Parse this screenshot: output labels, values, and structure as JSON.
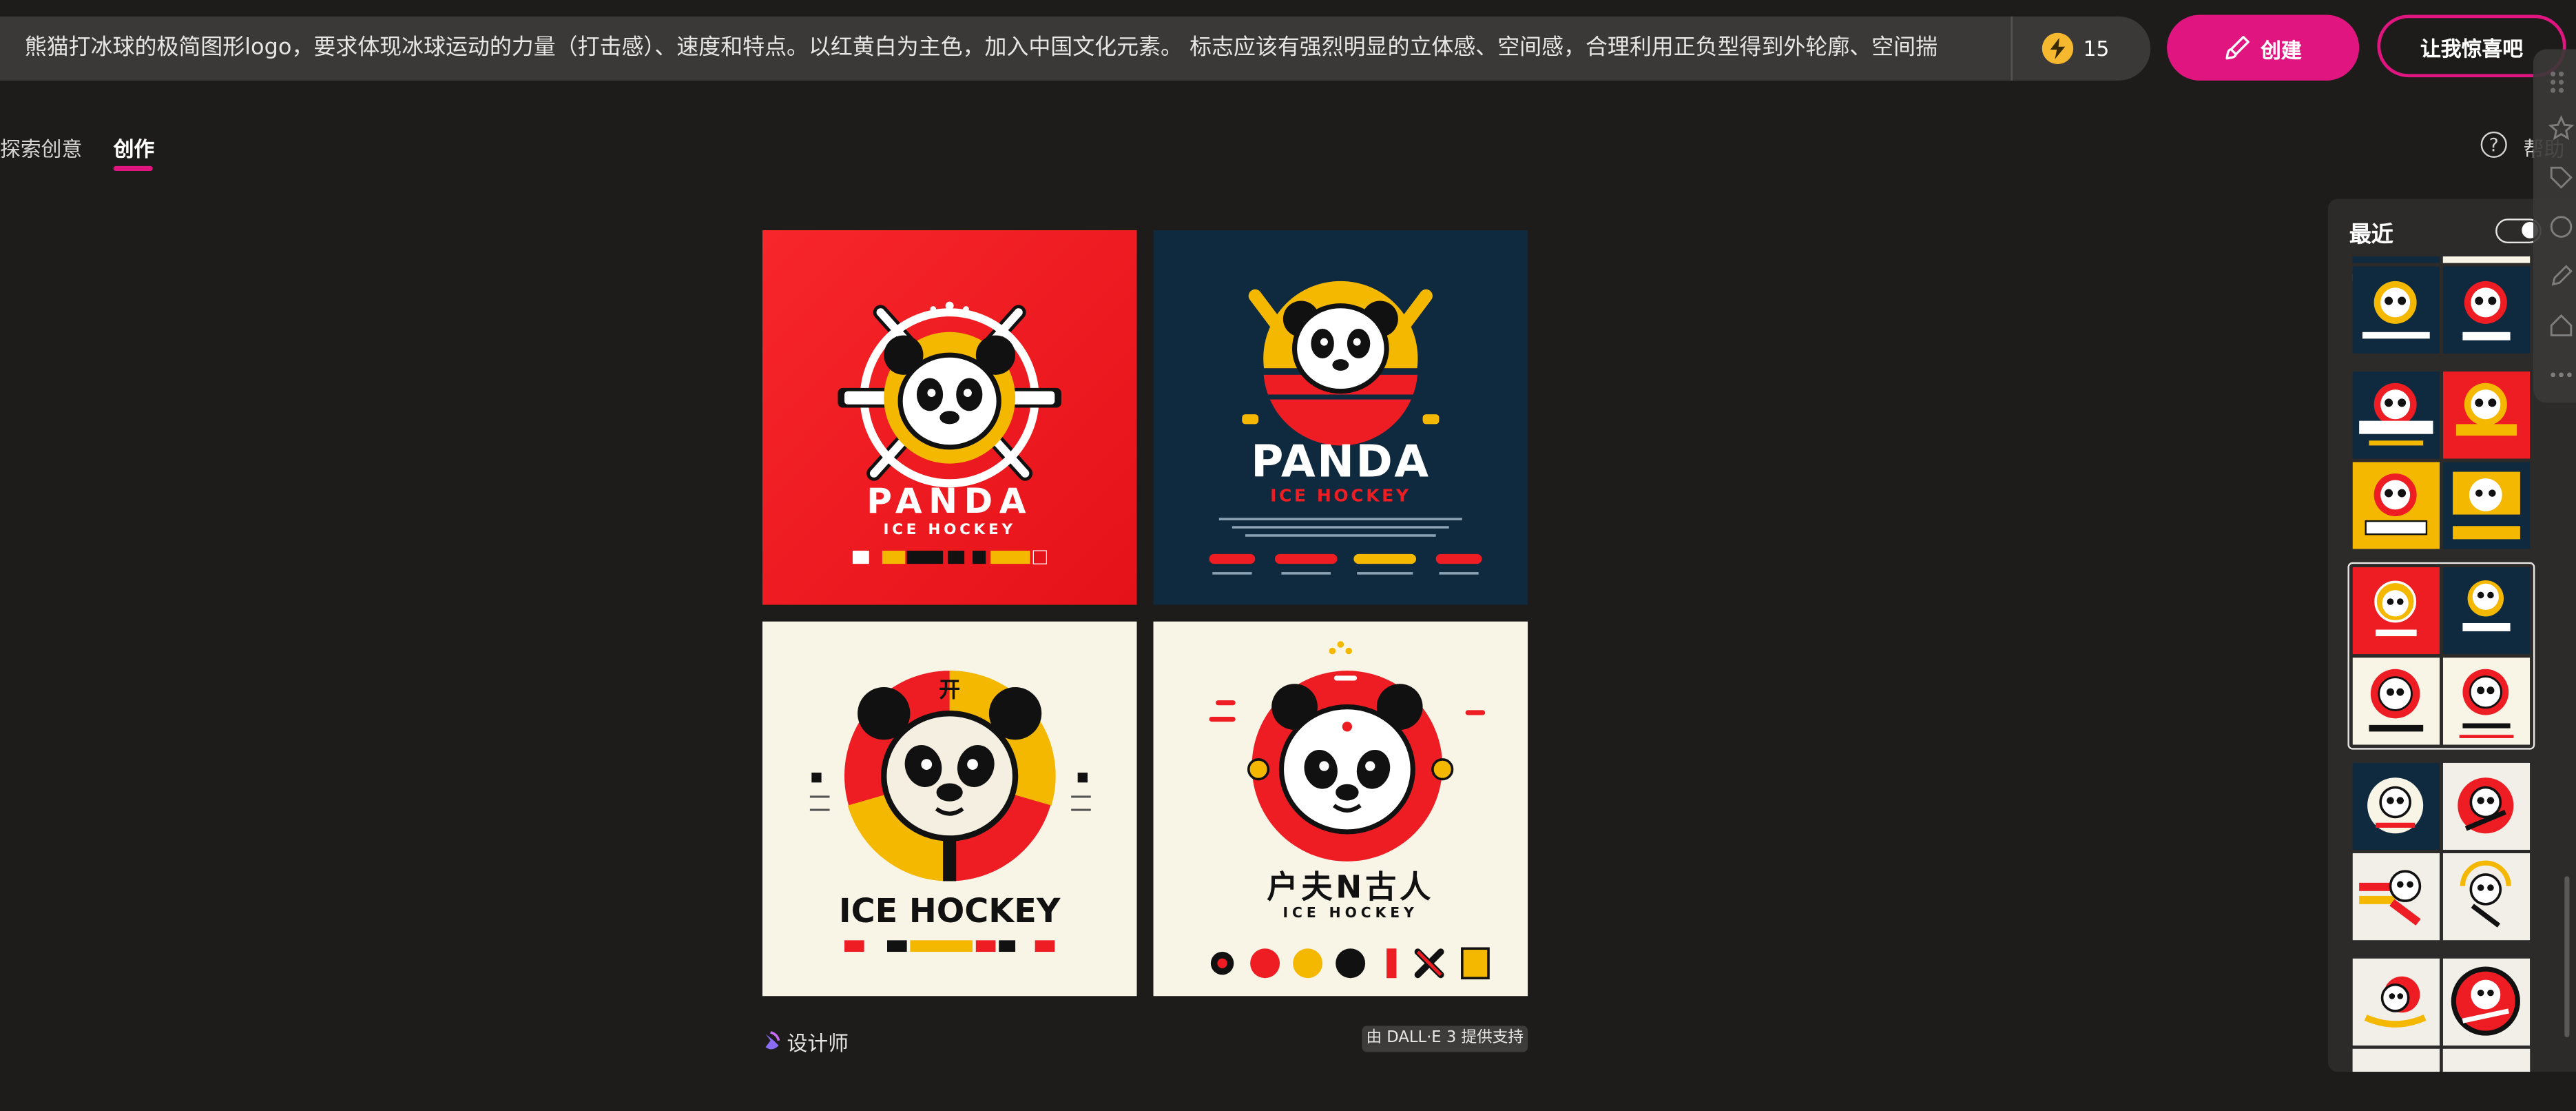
{
  "prompt": {
    "text": "熊猫打冰球的极简图形logo，要求体现冰球运动的力量（打击感）、速度和特点。以红黄白为主色，加入中国文化元素。 标志应该有强烈明显的立体感、空间感，合理利用正负型得到外轮廓、空间揣"
  },
  "boost": {
    "count": "15",
    "icon": "lightning-bolt-icon",
    "color": "#f5b82e"
  },
  "buttons": {
    "create_label": "创建",
    "surprise_label": "让我惊喜吧"
  },
  "tabs": {
    "explore_label": "探索创意",
    "create_label": "创作"
  },
  "help": {
    "label": "帮助",
    "icon_glyph": "?"
  },
  "footer": {
    "designer_label": "设计师",
    "powered_by": "由 DALL·E 3 提供支持"
  },
  "recent": {
    "title": "最近"
  },
  "colors": {
    "accent": "#e1157f",
    "background": "#1d1c1b",
    "panel": "#2c2b2a",
    "red": "#ee1d24",
    "yellow": "#f5b800",
    "navy": "#0f2a3e",
    "cream": "#f8f4e6"
  },
  "images": {
    "img1": {
      "title": "PANDA",
      "subtitle": "ICE HOCKEY"
    },
    "img2": {
      "title": "PANDA",
      "subtitle": "ICE HOCKEY"
    },
    "img3": {
      "title": "ICE HOCKEY",
      "glyph": "开"
    },
    "img4": {
      "title": "户夫N古人",
      "subtitle": "ICE HOCKEY"
    }
  }
}
